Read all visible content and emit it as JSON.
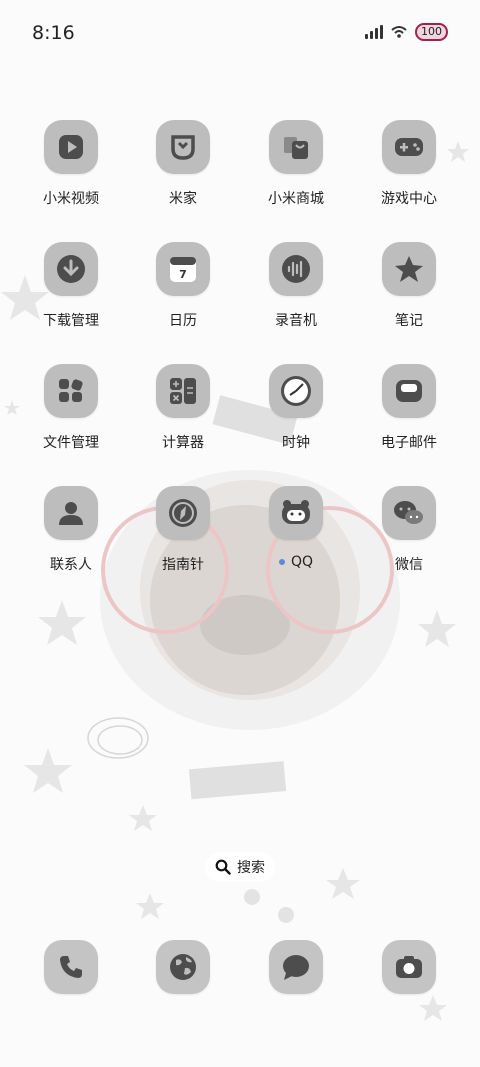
{
  "status": {
    "time": "8:16",
    "battery": "100"
  },
  "apps": [
    {
      "label": "小米视频",
      "icon": "play-icon"
    },
    {
      "label": "米家",
      "icon": "mijia-icon"
    },
    {
      "label": "小米商城",
      "icon": "shopping-bag-icon"
    },
    {
      "label": "游戏中心",
      "icon": "gamepad-icon"
    },
    {
      "label": "下载管理",
      "icon": "download-icon"
    },
    {
      "label": "日历",
      "icon": "calendar-icon",
      "badge": "7"
    },
    {
      "label": "录音机",
      "icon": "waveform-icon"
    },
    {
      "label": "笔记",
      "icon": "star-icon"
    },
    {
      "label": "文件管理",
      "icon": "folder-icon"
    },
    {
      "label": "计算器",
      "icon": "calculator-icon"
    },
    {
      "label": "时钟",
      "icon": "clock-icon"
    },
    {
      "label": "电子邮件",
      "icon": "mail-icon"
    },
    {
      "label": "联系人",
      "icon": "contact-icon"
    },
    {
      "label": "指南针",
      "icon": "compass-icon"
    },
    {
      "label": "QQ",
      "icon": "qq-icon",
      "new_dot": true
    },
    {
      "label": "微信",
      "icon": "wechat-icon"
    }
  ],
  "search": {
    "label": "搜索"
  },
  "dock": [
    {
      "icon": "phone-icon"
    },
    {
      "icon": "browser-icon"
    },
    {
      "icon": "message-icon"
    },
    {
      "icon": "camera-icon"
    }
  ],
  "colors": {
    "tile": "#bdbdbd",
    "glyph": "#4d4d4d",
    "accent_dot": "#5b8bd6"
  }
}
